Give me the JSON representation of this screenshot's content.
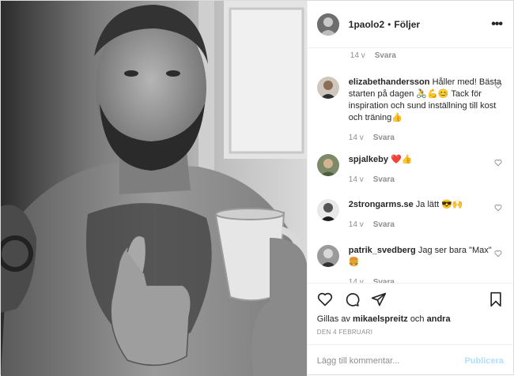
{
  "header": {
    "username": "1paolo2",
    "separator": "•",
    "follow_label": "Följer",
    "more_icon": "more-horizontal-icon"
  },
  "top_comment_meta": {
    "age": "14 v",
    "reply_label": "Svara"
  },
  "comments": [
    {
      "username": "elizabethandersson",
      "text": "Håller med! Bästa starten på dagen 🚴💪😊 Tack för inspiration och sund inställning till kost och träning👍",
      "age": "14 v",
      "reply_label": "Svara"
    },
    {
      "username": "spjalkeby",
      "text": "❤️👍",
      "age": "14 v",
      "reply_label": "Svara"
    },
    {
      "username": "2strongarms.se",
      "text": "Ja lätt 😎🙌",
      "age": "14 v",
      "reply_label": "Svara"
    },
    {
      "username": "patrik_svedberg",
      "text": "Jag ser bara \"Max\" 🍔",
      "age": "14 v",
      "reply_label": "Svara"
    }
  ],
  "actions": {
    "like_icon": "heart-icon",
    "comment_icon": "comment-icon",
    "share_icon": "send-icon",
    "save_icon": "bookmark-icon"
  },
  "likes": {
    "prefix": "Gillas av",
    "user": "mikaelspreitz",
    "conjunction": "och",
    "others": "andra"
  },
  "date": "DEN 4 FEBRUARI",
  "add_comment": {
    "placeholder": "Lägg till kommentar...",
    "publish_label": "Publicera"
  },
  "colors": {
    "text": "#262626",
    "muted": "#8e8e8e",
    "border": "#efefef",
    "publish_disabled": "#b2dffc"
  }
}
